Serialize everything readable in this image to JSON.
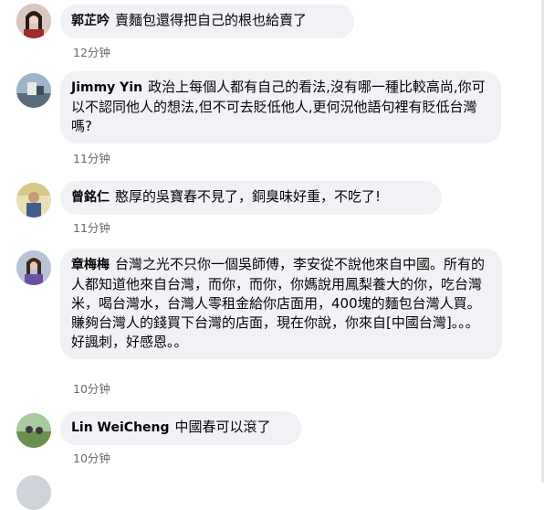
{
  "comments": [
    {
      "author": "郭芷吟",
      "text": "賣麵包還得把自己的根也給賣了",
      "time": "12分钟",
      "avatar_color": "#8a3b3b"
    },
    {
      "author": "Jimmy Yin",
      "text": "政治上每個人都有自己的看法,沒有哪一種比較高尚,你可以不認同他人的想法,但不可去貶低他人,更何況他語句裡有貶低台灣嗎?",
      "time": "11分钟",
      "avatar_color": "#4a6c8f"
    },
    {
      "author": "曾銘仁",
      "text": "憨厚的吳寶春不見了，銅臭味好重，不吃了!",
      "time": "11分钟",
      "avatar_color": "#b7a35a"
    },
    {
      "author": "章梅梅",
      "text": "台灣之光不只你一個吳師傅，李安從不說他來自中國。所有的人都知道他來自台灣，而你，而你，你媽說用鳳梨養大的你，吃台灣米，喝台灣水，台灣人零租金給你店面用，400塊的麵包台灣人買。賺夠台灣人的錢買下台灣的店面，現在你說，你來自[中國台灣]。。。好諷刺，好感恩。。",
      "time": "10分钟",
      "avatar_color": "#5c6f8a"
    },
    {
      "author": "Lin WeiCheng",
      "text": "中國春可以滾了",
      "time": "10分钟",
      "avatar_color": "#5f8a4a"
    }
  ]
}
